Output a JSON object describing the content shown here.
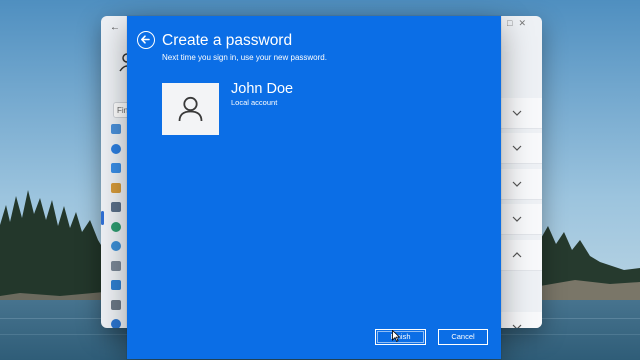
{
  "settings_window": {
    "search_placeholder": "Fin"
  },
  "dialog": {
    "title": "Create a password",
    "subtitle": "Next time you sign in, use your new password.",
    "user": {
      "name": "John Doe",
      "account_type": "Local account"
    },
    "buttons": {
      "finish": "Finish",
      "cancel": "Cancel"
    }
  },
  "icons": {
    "back": "back-arrow-icon",
    "avatar": "user-icon",
    "cursor": "mouse-pointer-icon"
  },
  "colors": {
    "dialog_bg": "#0b6ee6",
    "text": "#ffffff",
    "avatar_tile": "#f3f4f6",
    "settings_bg": "#eef1f5"
  }
}
